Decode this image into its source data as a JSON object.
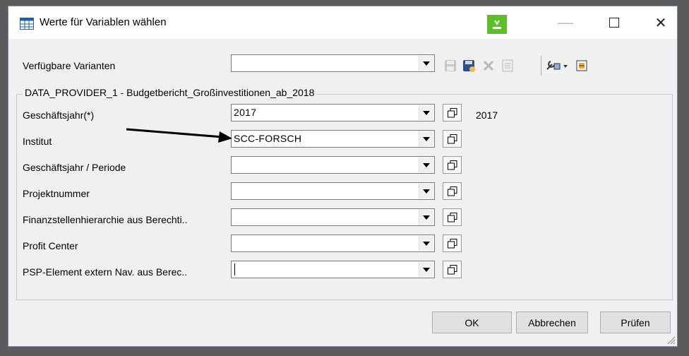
{
  "window": {
    "title": "Werte für Variablen wählen"
  },
  "variants": {
    "label": "Verfügbare Varianten",
    "value": ""
  },
  "group": {
    "title": "DATA_PROVIDER_1 - Budgetbericht_Großinvestitionen_ab_2018"
  },
  "fields": [
    {
      "label": "Geschäftsjahr(*)",
      "value": "2017",
      "text": "2017"
    },
    {
      "label": "Institut",
      "value": "SCC-FORSCH",
      "text": ""
    },
    {
      "label": "Geschäftsjahr / Periode",
      "value": "",
      "text": ""
    },
    {
      "label": "Projektnummer",
      "value": "",
      "text": ""
    },
    {
      "label": "Finanzstellenhierarchie  aus Berechti..",
      "value": "",
      "text": ""
    },
    {
      "label": "Profit Center",
      "value": "",
      "text": ""
    },
    {
      "label": "PSP-Element extern Nav. aus Berec..",
      "value": "",
      "text": ""
    }
  ],
  "buttons": {
    "ok": "OK",
    "cancel": "Abbrechen",
    "check": "Prüfen"
  },
  "icons": [
    "save-icon",
    "save-as-icon",
    "delete-icon",
    "details-icon",
    "tools-icon",
    "personalize-icon"
  ],
  "colors": {
    "badge": "#5cbf2a",
    "arrow": "#000000"
  }
}
